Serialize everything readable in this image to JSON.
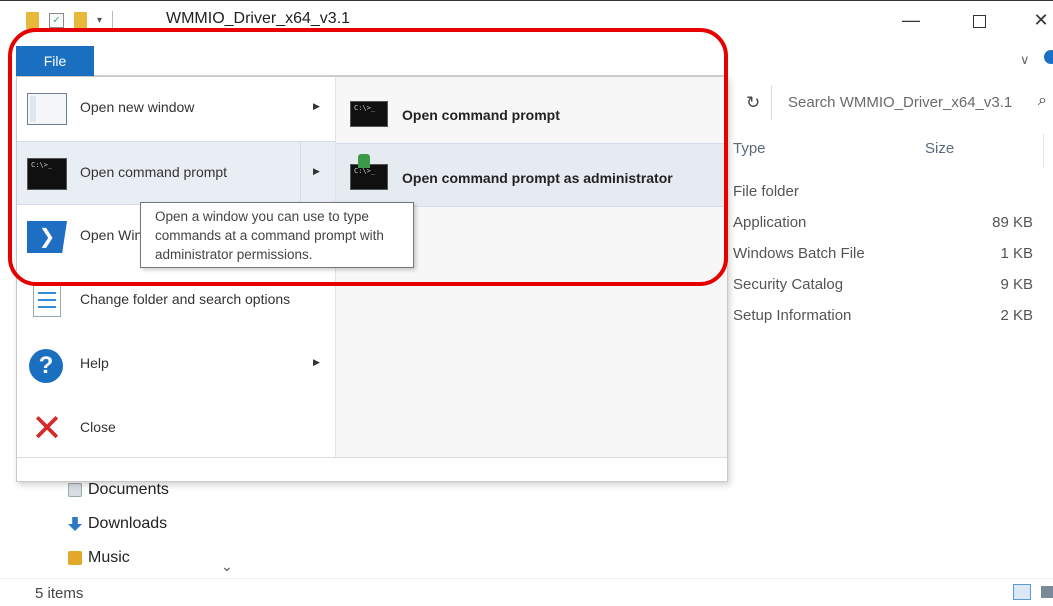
{
  "window": {
    "title": "WMMIO_Driver_x64_v3.1",
    "minimize_glyph": "—",
    "close_glyph": "✕",
    "ribbon_chevron": "∨"
  },
  "search": {
    "placeholder": "Search WMMIO_Driver_x64_v3.1",
    "refresh_glyph": "↻",
    "search_glyph": "⌕"
  },
  "file_list": {
    "columns": [
      "Type",
      "Size"
    ],
    "rows": [
      {
        "type": "File folder",
        "size": ""
      },
      {
        "type": "Application",
        "size": "89 KB"
      },
      {
        "type": "Windows Batch File",
        "size": "1 KB"
      },
      {
        "type": "Security Catalog",
        "size": "9 KB"
      },
      {
        "type": "Setup Information",
        "size": "2 KB"
      }
    ]
  },
  "nav": {
    "items": [
      "Documents",
      "Downloads",
      "Music"
    ],
    "scroll_glyph": "⌄"
  },
  "status": {
    "item_count": "5 items"
  },
  "file_menu": {
    "tab_label": "File",
    "items": [
      {
        "label": "Open new window",
        "icon": "window-icon",
        "has_submenu": true
      },
      {
        "label": "Open command prompt",
        "icon": "command-prompt-icon",
        "has_submenu": true
      },
      {
        "label": "Open Windows PowerShell",
        "icon": "powershell-icon",
        "has_submenu": true
      },
      {
        "label": "Change folder and search options",
        "icon": "folder-options-icon",
        "has_submenu": false
      },
      {
        "label": "Help",
        "icon": "help-icon",
        "has_submenu": true
      },
      {
        "label": "Close",
        "icon": "close-icon",
        "has_submenu": false
      }
    ],
    "submenu_arrow": "▶",
    "submenu": [
      {
        "label": "Open command prompt"
      },
      {
        "label": "Open command prompt as administrator"
      }
    ],
    "cmd_icon_text": "C:\\>_",
    "ps_icon_glyph": "❯",
    "help_icon_glyph": "?",
    "close_icon_glyph": "✕",
    "tooltip": "Open a window you can use to type commands at a command prompt with administrator permissions."
  },
  "colors": {
    "accent": "#1a6fc1",
    "highlight_outline": "#e60000"
  }
}
